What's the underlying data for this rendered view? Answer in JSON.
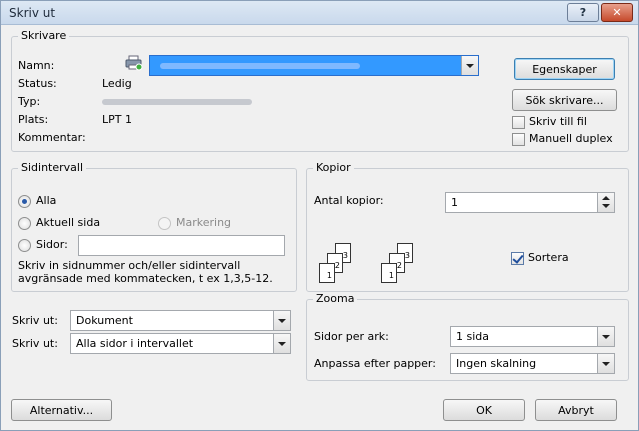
{
  "window": {
    "title": "Skriv ut",
    "help_label": "?",
    "close_label": "✕"
  },
  "printer": {
    "group_label": "Skrivare",
    "name_label": "Namn:",
    "status_label": "Status:",
    "status_value": "Ledig",
    "type_label": "Typ:",
    "location_label": "Plats:",
    "location_value": "LPT 1",
    "comment_label": "Kommentar:",
    "properties_button": "Egenskaper",
    "find_printer_button": "Sök skrivare...",
    "print_to_file_label": "Skriv till fil",
    "print_to_file_checked": false,
    "manual_duplex_label": "Manuell duplex",
    "manual_duplex_checked": false,
    "icon": "printer-icon"
  },
  "page_range": {
    "group_label": "Sidintervall",
    "all_label": "Alla",
    "current_page_label": "Aktuell sida",
    "selection_label": "Markering",
    "pages_label": "Sidor:",
    "pages_value": "",
    "help_text_line1": "Skriv in sidnummer och/eller sidintervall",
    "help_text_line2": "avgränsade med kommatecken, t ex 1,3,5-12.",
    "selected": "all"
  },
  "copies": {
    "group_label": "Kopior",
    "count_label": "Antal kopior:",
    "count_value": "1",
    "collate_label": "Sortera",
    "collate_checked": true,
    "page_numbers_set1": [
      "3",
      "2",
      "1"
    ],
    "page_numbers_set2": [
      "3",
      "2",
      "1"
    ]
  },
  "print_what": {
    "label": "Skriv ut:",
    "value": "Dokument"
  },
  "print": {
    "label": "Skriv ut:",
    "value": "Alla sidor i intervallet"
  },
  "zoom": {
    "group_label": "Zooma",
    "pages_per_sheet_label": "Sidor per ark:",
    "pages_per_sheet_value": "1 sida",
    "scale_label": "Anpassa efter papper:",
    "scale_value": "Ingen skalning"
  },
  "footer": {
    "options_button": "Alternativ...",
    "ok_button": "OK",
    "cancel_button": "Avbryt"
  },
  "colors": {
    "accent": "#3399ff",
    "titlebar": "#c9d9ec",
    "close": "#c64a2c"
  }
}
